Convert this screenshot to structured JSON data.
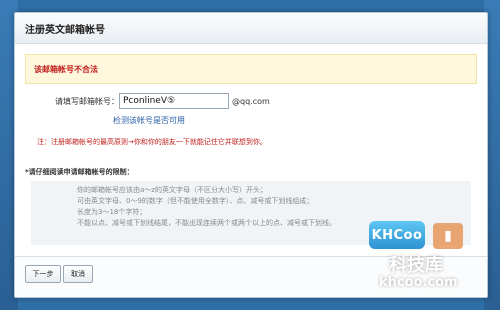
{
  "dialog": {
    "title": "注册英文邮箱帐号",
    "error": "该邮箱帐号不合法",
    "email_label": "请填写邮箱帐号：",
    "email_value": "PconlineV⑤",
    "email_suffix": "@qq.com",
    "check_link": "检测该帐号是否可用",
    "note": "注：注册邮箱帐号的最高原则→你和你的朋友一下就能记住它并联想到你。",
    "rules_title": "*请仔细阅读申请邮箱帐号的限制：",
    "rules": [
      "你的邮箱帐号应该由a～z的英文字母（不区分大小写）开头；",
      "可由英文字母、0～9的数字（但不能使用全数字）、点、减号或下划线组成；",
      "长度为3～18个字符；",
      "不能以点、减号或下划线结尾，不能出现连续两个或两个以上的点、减号或下划线。"
    ],
    "buttons": {
      "next": "下一步",
      "cancel": "取消"
    }
  },
  "watermark": {
    "brand": "KHCoo",
    "cn": "科技库",
    "url": "khcoo.com"
  },
  "colors": {
    "background": "#2f6fa8",
    "error_text": "#c0201f",
    "link": "#2a5ea8"
  }
}
